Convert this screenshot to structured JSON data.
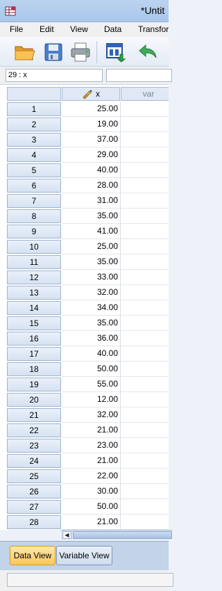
{
  "window": {
    "title": "*Untit"
  },
  "menu": [
    "File",
    "Edit",
    "View",
    "Data",
    "Transfor"
  ],
  "toolbar": {
    "buttons": [
      "open-folder-icon",
      "save-icon",
      "print-icon",
      "dialog-recall-icon",
      "undo-icon"
    ]
  },
  "cell_reference": "29 : x",
  "columns": [
    "x",
    "var"
  ],
  "rows": [
    {
      "n": "1",
      "x": "25.00"
    },
    {
      "n": "2",
      "x": "19.00"
    },
    {
      "n": "3",
      "x": "37.00"
    },
    {
      "n": "4",
      "x": "29.00"
    },
    {
      "n": "5",
      "x": "40.00"
    },
    {
      "n": "6",
      "x": "28.00"
    },
    {
      "n": "7",
      "x": "31.00"
    },
    {
      "n": "8",
      "x": "35.00"
    },
    {
      "n": "9",
      "x": "41.00"
    },
    {
      "n": "10",
      "x": "25.00"
    },
    {
      "n": "11",
      "x": "35.00"
    },
    {
      "n": "12",
      "x": "33.00"
    },
    {
      "n": "13",
      "x": "32.00"
    },
    {
      "n": "14",
      "x": "34.00"
    },
    {
      "n": "15",
      "x": "35.00"
    },
    {
      "n": "16",
      "x": "36.00"
    },
    {
      "n": "17",
      "x": "40.00"
    },
    {
      "n": "18",
      "x": "50.00"
    },
    {
      "n": "19",
      "x": "55.00"
    },
    {
      "n": "20",
      "x": "12.00"
    },
    {
      "n": "21",
      "x": "32.00"
    },
    {
      "n": "22",
      "x": "21.00"
    },
    {
      "n": "23",
      "x": "23.00"
    },
    {
      "n": "24",
      "x": "21.00"
    },
    {
      "n": "25",
      "x": "22.00"
    },
    {
      "n": "26",
      "x": "30.00"
    },
    {
      "n": "27",
      "x": "50.00"
    },
    {
      "n": "28",
      "x": "21.00"
    }
  ],
  "tabs": {
    "data_view": "Data View",
    "variable_view": "Variable View"
  },
  "colors": {
    "active_tab": "#f9c760",
    "title_bar": "#bcd3f0",
    "row_header": "#d6e2f2"
  }
}
